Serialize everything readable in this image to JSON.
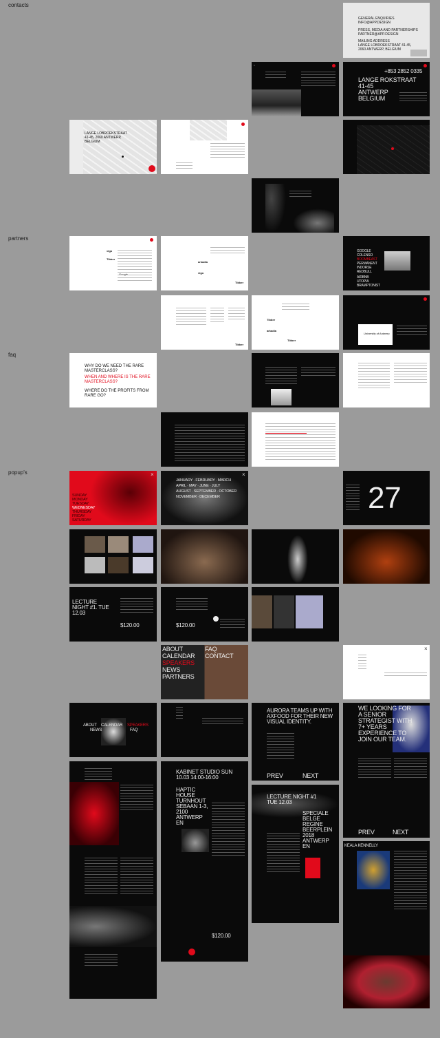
{
  "sections": {
    "contacts": "contacts",
    "partners": "partners",
    "faq": "faq",
    "popups": "popup's"
  },
  "contacts": {
    "general_enquiries": "GENERAL ENQUIRIES",
    "info_email": "INFO@APP.DESIGN",
    "press": "PRESS, MEDIA AND PARTNERSHIPS",
    "partner_email": "PARTNER@APP.DESIGN",
    "mailing": "MAILING ADDRESS",
    "mailing_addr": "LANGE LOBROEKSTRAAT 41-45,",
    "mailing_city": "2060 ANTWERP, BELGIUM",
    "phone": "+853 2852 0335",
    "addr_line1": "LANGE ROKSTRAAT",
    "addr_line2": "41-45",
    "addr_line3": "ANTWERP",
    "addr_line4": "BELGIUM",
    "map_addr1": "LANGE LOBROEKSTRAAT",
    "map_addr2": "41-45, 2060 ANTWERP,",
    "map_addr3": "BELGIUM"
  },
  "partners": {
    "list": [
      "GOOGLE",
      "COLENSO",
      "BOOMBEAST",
      "PERMANENT",
      "INDORSE",
      "REDBULL",
      "AIRBNB",
      "UTOPIA",
      "BRAMPTONIST"
    ],
    "logos": [
      "vigo",
      "arkadia",
      "Tibber",
      "Google",
      "University of Antwerp"
    ]
  },
  "faq": {
    "q1": "WHY DO WE NEED THE RARE MASTERCLASS?",
    "q2": "WHEN AND WHERE IS THE RARE MASTERCLASS?",
    "q3": "WHERE DO THE PROFITS FROM RARE GO?"
  },
  "popups": {
    "days": [
      "SUNDAY",
      "MONDAY",
      "TUESDAY",
      "WEDNESDAY",
      "THURSDAY",
      "FRIDAY",
      "SATURDAY"
    ],
    "months_row1": "JANUARY · FEBRUARY · MARCH",
    "months_row2": "APRIL · MAY · JUNE · JULY",
    "months_row3": "AUGUST · SEPTEMBER · OCTOBER",
    "months_row4": "NOVEMBER · DECEMBER",
    "day_number": "27",
    "lecture": "LECTURE NIGHT #1. TUE 12.03",
    "price": "$120.00",
    "menu": {
      "about": "ABOUT",
      "faq": "FAQ",
      "calendar": "CALENDAR",
      "contact": "CONTACT",
      "speakers": "SPEAKERS",
      "news": "NEWS",
      "partners": "PARTNERS"
    },
    "news_title": "AURORA TEAMS UP WITH AXFOOD FOR THEIR NEW VISUAL IDENTITY.",
    "prev": "PREV",
    "next": "NEXT",
    "job_title": "WE LOOKING FOR A SENIOR STRATEGIST WITH 7+ YEARS EXPERIENCE TO JOIN OUR TEAM.",
    "kabinet": "KABINET STUDIO SUN 10.03 14:00-16:00",
    "haptic": "HAPTIC HOUSE TURNHOUT SEBAAN 1-3, 2100 ANTWERP EN",
    "lecture2": "LECTURE NIGHT #1 TUE 12.03",
    "speciale": "SPECIALE BELGE REGINE BEERPLEIN 2018 ANTWERP EN",
    "keala": "KEALA KENNELLY"
  },
  "colors": {
    "accent": "#e10a1b",
    "bg": "#9b9b9b",
    "dark": "#0a0a0a"
  }
}
